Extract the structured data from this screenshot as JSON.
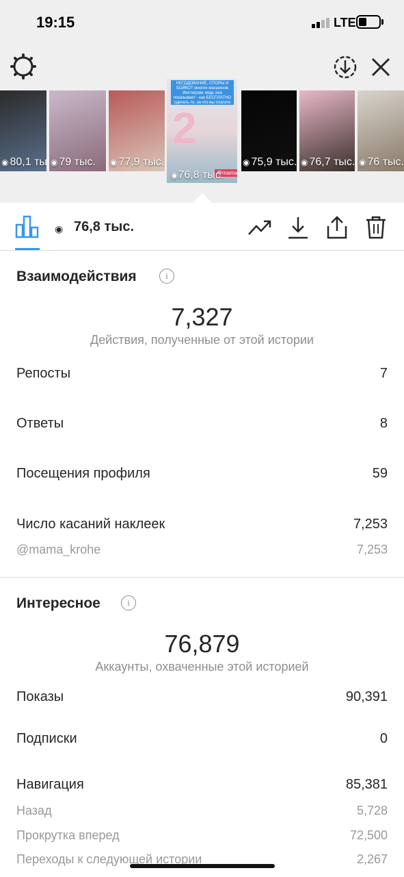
{
  "status_bar": {
    "time": "19:15",
    "network": "LTE"
  },
  "header": {
    "settings_icon": "gear-icon",
    "download_icon": "download-circle-icon",
    "close_icon": "close-icon"
  },
  "stories": [
    {
      "views": "80,1 тыс.",
      "colors": [
        "#2b2b2b",
        "#5a6f8c"
      ]
    },
    {
      "views": "79 тыс.",
      "colors": [
        "#c9b9c9",
        "#8a6a7a"
      ]
    },
    {
      "views": "77,9 тыс.",
      "colors": [
        "#b95a5a",
        "#d8c5b8"
      ]
    },
    {
      "views": "75,9 тыс.",
      "colors": [
        "#050505",
        "#101010"
      ]
    },
    {
      "views": "76,7 тыс.",
      "colors": [
        "#e8b8c8",
        "#3a2f2a"
      ]
    },
    {
      "views": "76 тыс.",
      "colors": [
        "#d9d4cc",
        "#8a7a6a"
      ]
    }
  ],
  "selected_story": {
    "views": "76,8 тыс.",
    "caption": "НЕГОДОВАНИЕ, СПОРЫ И БОЙКОТ многих магазинов Инстаграм, ведь она показывает - как БЕСПЛАТНО сделать то, за что вы платите большие деньги!",
    "big_digit": "2",
    "tag": "@mama_krohe"
  },
  "toolbar": {
    "views_label": "76,8 тыс.",
    "icons": [
      "bar-chart-icon",
      "eye-icon",
      "trending-icon",
      "download-icon",
      "share-icon",
      "trash-icon"
    ]
  },
  "interactions": {
    "title": "Взаимодействия",
    "total": "7,327",
    "subtitle": "Действия, полученные от этой истории",
    "rows": [
      {
        "label": "Репосты",
        "value": "7"
      },
      {
        "label": "Ответы",
        "value": "8"
      },
      {
        "label": "Посещения профиля",
        "value": "59"
      },
      {
        "label": "Число касаний наклеек",
        "value": "7,253"
      }
    ],
    "sub_rows": [
      {
        "label": "@mama_krohe",
        "value": "7,253"
      }
    ]
  },
  "discovery": {
    "title": "Интересное",
    "total": "76,879",
    "subtitle": "Аккаунты, охваченные этой историей",
    "rows": [
      {
        "label": "Показы",
        "value": "90,391"
      },
      {
        "label": "Подписки",
        "value": "0"
      },
      {
        "label": "Навигация",
        "value": "85,381"
      }
    ],
    "sub_rows": [
      {
        "label": "Назад",
        "value": "5,728"
      },
      {
        "label": "Прокрутка вперед",
        "value": "72,500"
      },
      {
        "label": "Переходы к следующей истории",
        "value": "2,267"
      }
    ]
  },
  "colors": {
    "accent": "#3897f0",
    "header_bg": "#efefef",
    "text": "#262626",
    "muted": "#8e8e8e"
  }
}
